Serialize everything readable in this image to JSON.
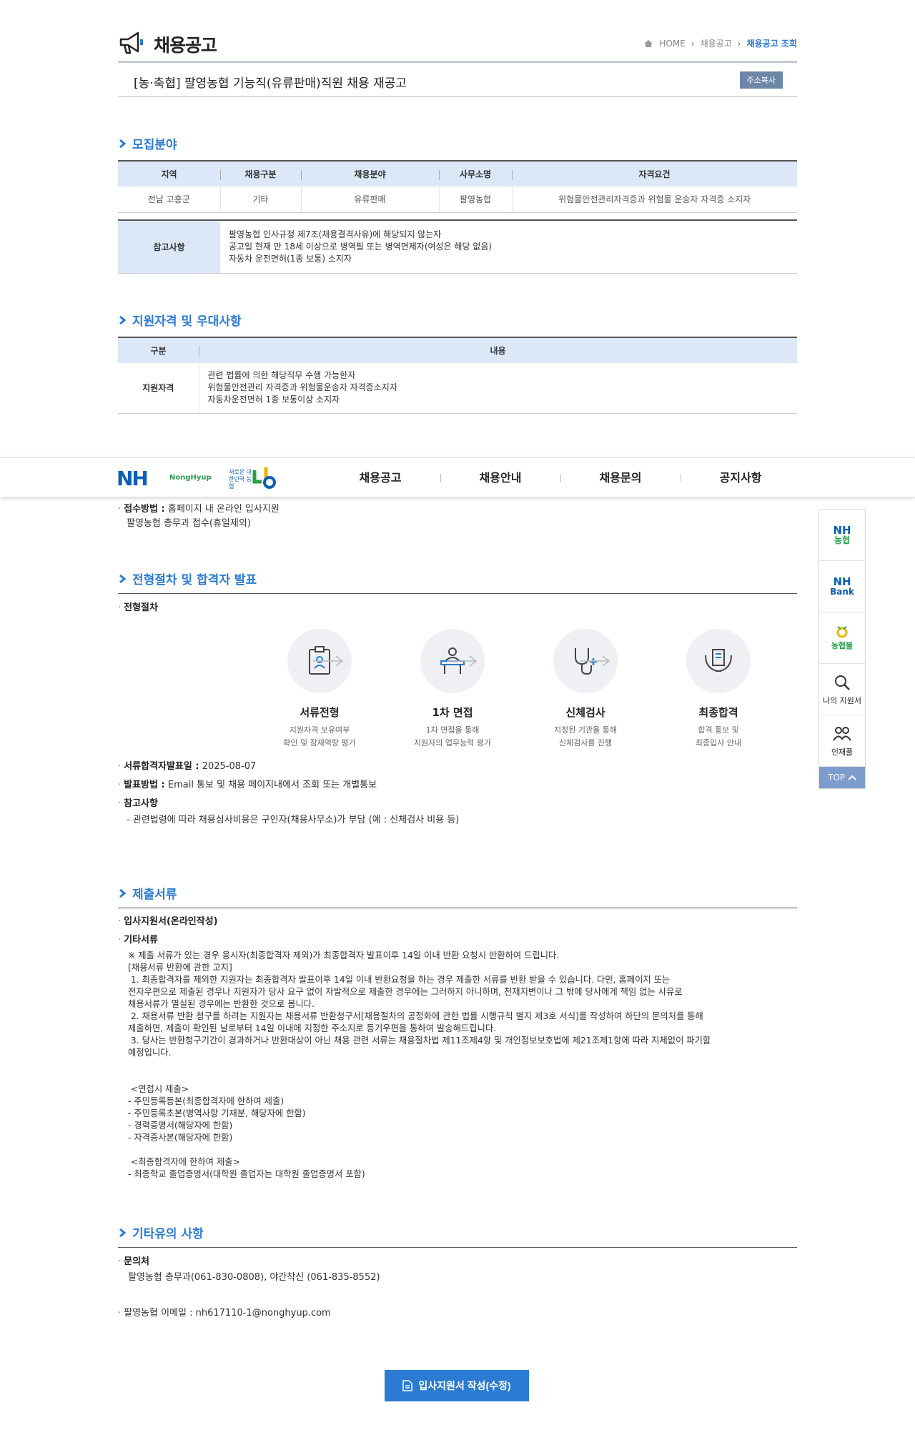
{
  "page": {
    "title": "채용공고",
    "breadcrumb": [
      "HOME",
      "채용공고",
      "채용공고 조회"
    ]
  },
  "post": {
    "title": "[농·축협] 팔영농협 기능직(유류판매)직원 채용 재공고",
    "copy_button": "주소복사"
  },
  "recruit": {
    "title": "모집분야",
    "headers": [
      "지역",
      "채용구분",
      "채용분야",
      "사무소명",
      "자격요건"
    ],
    "row": [
      "전남 고흥군",
      "기타",
      "유류판매",
      "팔영농협",
      "위험물안전관리자격증과 위험물 운송자 자격증 소지자"
    ],
    "note_label": "참고사항",
    "notes": [
      "팔영농협 인사규정 제7조(채용결격사유)에 해당되지 않는자",
      "공고일 현재 만 18세 이상으로 병역필 또는 병역면제자(여성은 해당 없음)",
      "자동차 운전면허(1종 보통) 소지자"
    ]
  },
  "qualify": {
    "title": "지원자격 및 우대사항",
    "headers": [
      "구분",
      "내용"
    ],
    "label": "지원자격",
    "lines": [
      "관련 법률에 의한 해당직무 수행 가능한자",
      "위험물안전관리 자격증과 위험물운송자 자격증소지자",
      "자동차운전면허 1종 보통이상 소지자"
    ]
  },
  "receipt": {
    "method_label": "접수방법 :",
    "method_value": "홈페이지 내 온라인 입사지원",
    "method_line2": "팔영농협 총무과 접수(휴일제외)"
  },
  "nav": {
    "logo": "NH",
    "logo_sub": "NongHyup",
    "logo2": "새로운 대한민국 농협",
    "menu": [
      "채용공고",
      "채용안내",
      "채용문의",
      "공지사항"
    ]
  },
  "quick": {
    "items": [
      {
        "top": "NH",
        "bottom": "농협"
      },
      {
        "top": "NH",
        "bottom": "Bank"
      },
      {
        "label": "농협몰"
      },
      {
        "label": "나의 지원서"
      },
      {
        "label": "인재풀"
      }
    ],
    "top": "TOP"
  },
  "process": {
    "title": "전형절차 및 합격자 발표",
    "sub": "전형절차",
    "steps": [
      {
        "name": "서류전형",
        "desc1": "지원자격 보유여부",
        "desc2": "확인 및 잠재역량 평가"
      },
      {
        "name": "1차 면접",
        "desc1": "1차 면접을 통해",
        "desc2": "지원자의 업무능력 평가"
      },
      {
        "name": "신체검사",
        "desc1": "지정된 기관을 통해",
        "desc2": "신체검사를 진행"
      },
      {
        "name": "최종합격",
        "desc1": "합격 통보 및",
        "desc2": "최종입사 안내"
      }
    ],
    "announce_label": "서류합격자발표일 :",
    "announce_value": "2025-08-07",
    "method_label": "발표방법 :",
    "method_value": "Email 통보 및 채용 페이지내에서 조회 또는 개별통보",
    "ref_label": "참고사항",
    "ref_value": "- 관련법령에 따라 채용심사비용은 구인자(채용사무소)가 부담 (예 : 신체검사 비용 등)"
  },
  "docs": {
    "title": "제출서류",
    "item1": "입사지원서(온라인작성)",
    "item2": "기타서류",
    "body": "※ 제출 서류가 있는 경우 응시자(최종합격자 제외)가 최종합격자 발표이후 14일 이내 반환 요청시 반환하여 드립니다.\n[채용서류 반환에 관한 고지]\n 1. 최종합격자를 제외한 지원자는 최종합격자 발표이후 14일 이내 반환요청을 하는 경우 제출한 서류를 반환 받을 수 있습니다. 다만, 홈페이지 또는\n전자우편으로 제출된 경우나 지원자가 당사 요구 없이 자발적으로 제출한 경우에는 그러하지 아니하며, 천재지변이나 그 밖에 당사에게 책임 없는 사유로\n채용서류가 멸실된 경우에는 반환한 것으로 봅니다.\n 2. 채용서류 반환 청구를 하려는 지원자는 채용서류 반환청구서[채용절차의 공정화에 관한 법률 시행규칙 별지 제3호 서식]를 작성하여 하단의 문의처를 통해\n제출하면, 제출이 확인된 날로부터 14일 이내에 지정한 주소지로 등기우편을 통하여 발송해드립니다.\n 3. 당사는 반환청구기간이 경과하거나 반환대상이 아닌 채용 관련 서류는 채용절차법 제11조제4항 및 개인정보보호법에 제21조제1항에 따라 지체없이 파기할\n예정입니다.\n\n\n <면접시 제출>\n- 주민등록등본(최종합격자에 한하여 제출)\n- 주민등록초본(병역사항 기재분, 해당자에 한함)\n- 경력증명서(해당자에 한함)\n- 자격증사본(해당자에 한함)\n\n <최종합격자에 한하여 제출>\n- 최종학교 졸업증명서(대학원 졸업자는 대학원 졸업증명서 포함)"
  },
  "etc": {
    "title": "기타유의 사항",
    "contact_label": "문의처",
    "contact_value": "팔영농협 총무과(061-830-0808), 야간착신 (061-835-8552)",
    "email": "팔영농협 이메일 : nh617110-1@nonghyup.com"
  },
  "apply_button": "입사지원서 작성(수정)",
  "colors": {
    "accent": "#2a7bd1",
    "table_head": "#dce8f7",
    "brand_blue": "#0a5eb4",
    "brand_green": "#2aa14b"
  }
}
